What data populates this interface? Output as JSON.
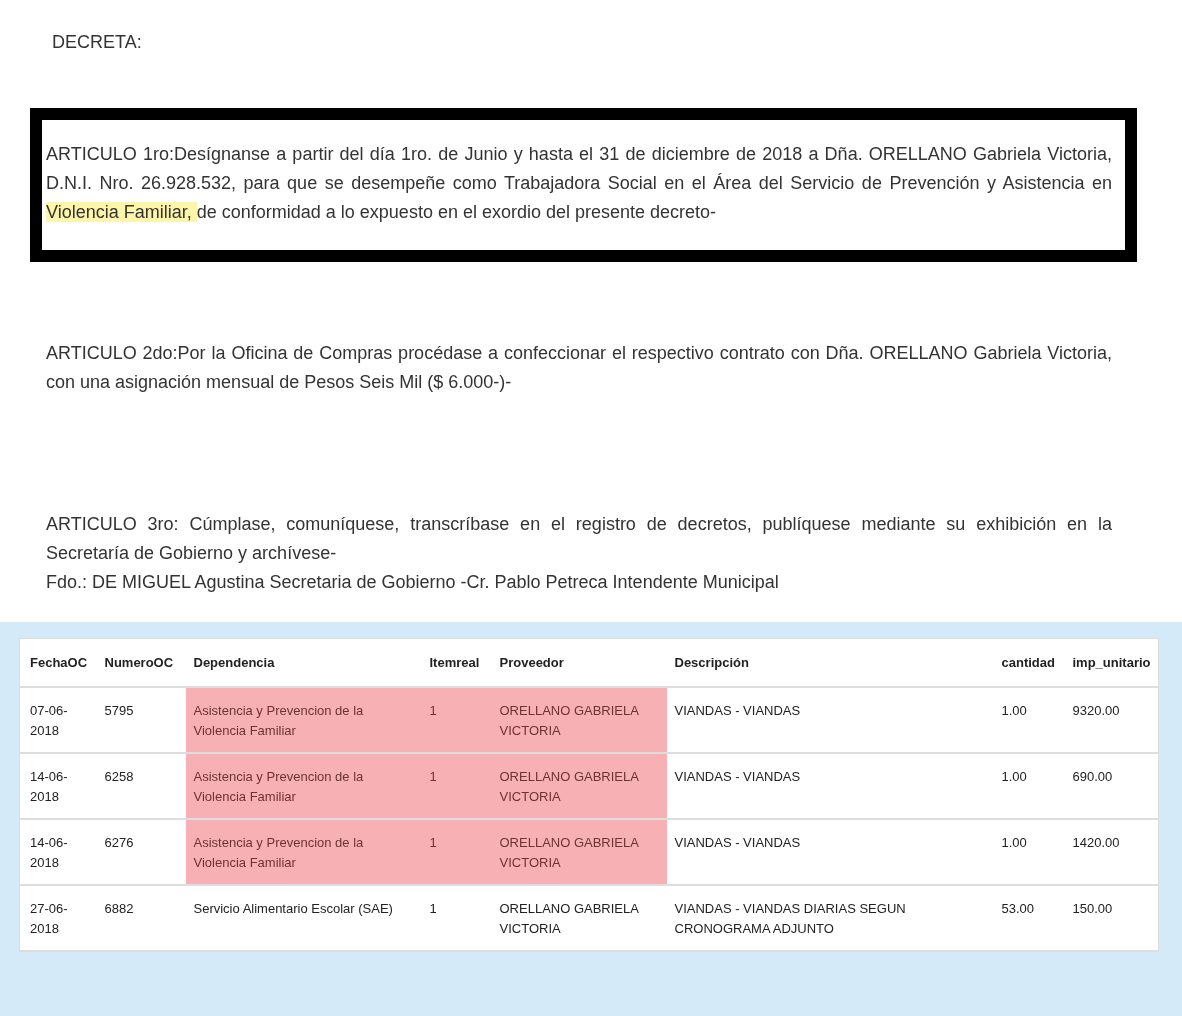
{
  "document": {
    "heading": "DECRETA:",
    "articles": [
      {
        "boxed": true,
        "segments": [
          {
            "text": "ARTICULO 1ro:Desígnanse a partir del día 1ro. de Junio y hasta el 31 de diciembre de 2018 a Dña. ORELLANO Gabriela Victoria, D.N.I. Nro. 26.928.532, para que se desempeñe como Trabajadora Social en el Área del Servicio de Prevención y Asistencia en ",
            "highlighted": false
          },
          {
            "text": "Violencia Familiar, ",
            "highlighted": true
          },
          {
            "text": "de conformidad a lo expuesto en el exordio del presente decreto-",
            "highlighted": false
          }
        ]
      },
      {
        "boxed": false,
        "segments": [
          {
            "text": "ARTICULO 2do:Por la Oficina de Compras procédase a confeccionar el respectivo contrato con Dña. ORELLANO Gabriela Victoria, con una asignación mensual de Pesos Seis Mil ($ 6.000-)-",
            "highlighted": false
          }
        ]
      },
      {
        "boxed": false,
        "segments": [
          {
            "text": "ARTICULO 3ro: Cúmplase, comuníquese, transcríbase en el registro de decretos, publíquese mediante su exhibición en la Secretaría de Gobierno y archívese-",
            "highlighted": false
          }
        ],
        "signature": "Fdo.: DE MIGUEL Agustina Secretaria de Gobierno -Cr. Pablo Petreca Intendente Municipal"
      }
    ]
  },
  "table": {
    "columns": [
      "FechaOC",
      "NumeroOC",
      "Dependencia",
      "Itemreal",
      "Proveedor",
      "Descripción",
      "cantidad",
      "imp_unitario"
    ],
    "rows": [
      {
        "highlighted": true,
        "cells": [
          "07-06-2018",
          "5795",
          "Asistencia y Prevencion de la Violencia Familiar",
          "1",
          "ORELLANO GABRIELA VICTORIA",
          "VIANDAS - VIANDAS",
          "1.00",
          "9320.00"
        ]
      },
      {
        "highlighted": true,
        "cells": [
          "14-06-2018",
          "6258",
          "Asistencia y Prevencion de la Violencia Familiar",
          "1",
          "ORELLANO GABRIELA VICTORIA",
          "VIANDAS - VIANDAS",
          "1.00",
          "690.00"
        ]
      },
      {
        "highlighted": true,
        "cells": [
          "14-06-2018",
          "6276",
          "Asistencia y Prevencion de la Violencia Familiar",
          "1",
          "ORELLANO GABRIELA VICTORIA",
          "VIANDAS - VIANDAS",
          "1.00",
          "1420.00"
        ]
      },
      {
        "highlighted": false,
        "cells": [
          "27-06-2018",
          "6882",
          "Servicio Alimentario Escolar (SAE)",
          "1",
          "ORELLANO GABRIELA VICTORIA",
          "VIANDAS - VIANDAS DIARIAS SEGUN CRONOGRAMA ADJUNTO",
          "53.00",
          "150.00"
        ]
      }
    ]
  }
}
